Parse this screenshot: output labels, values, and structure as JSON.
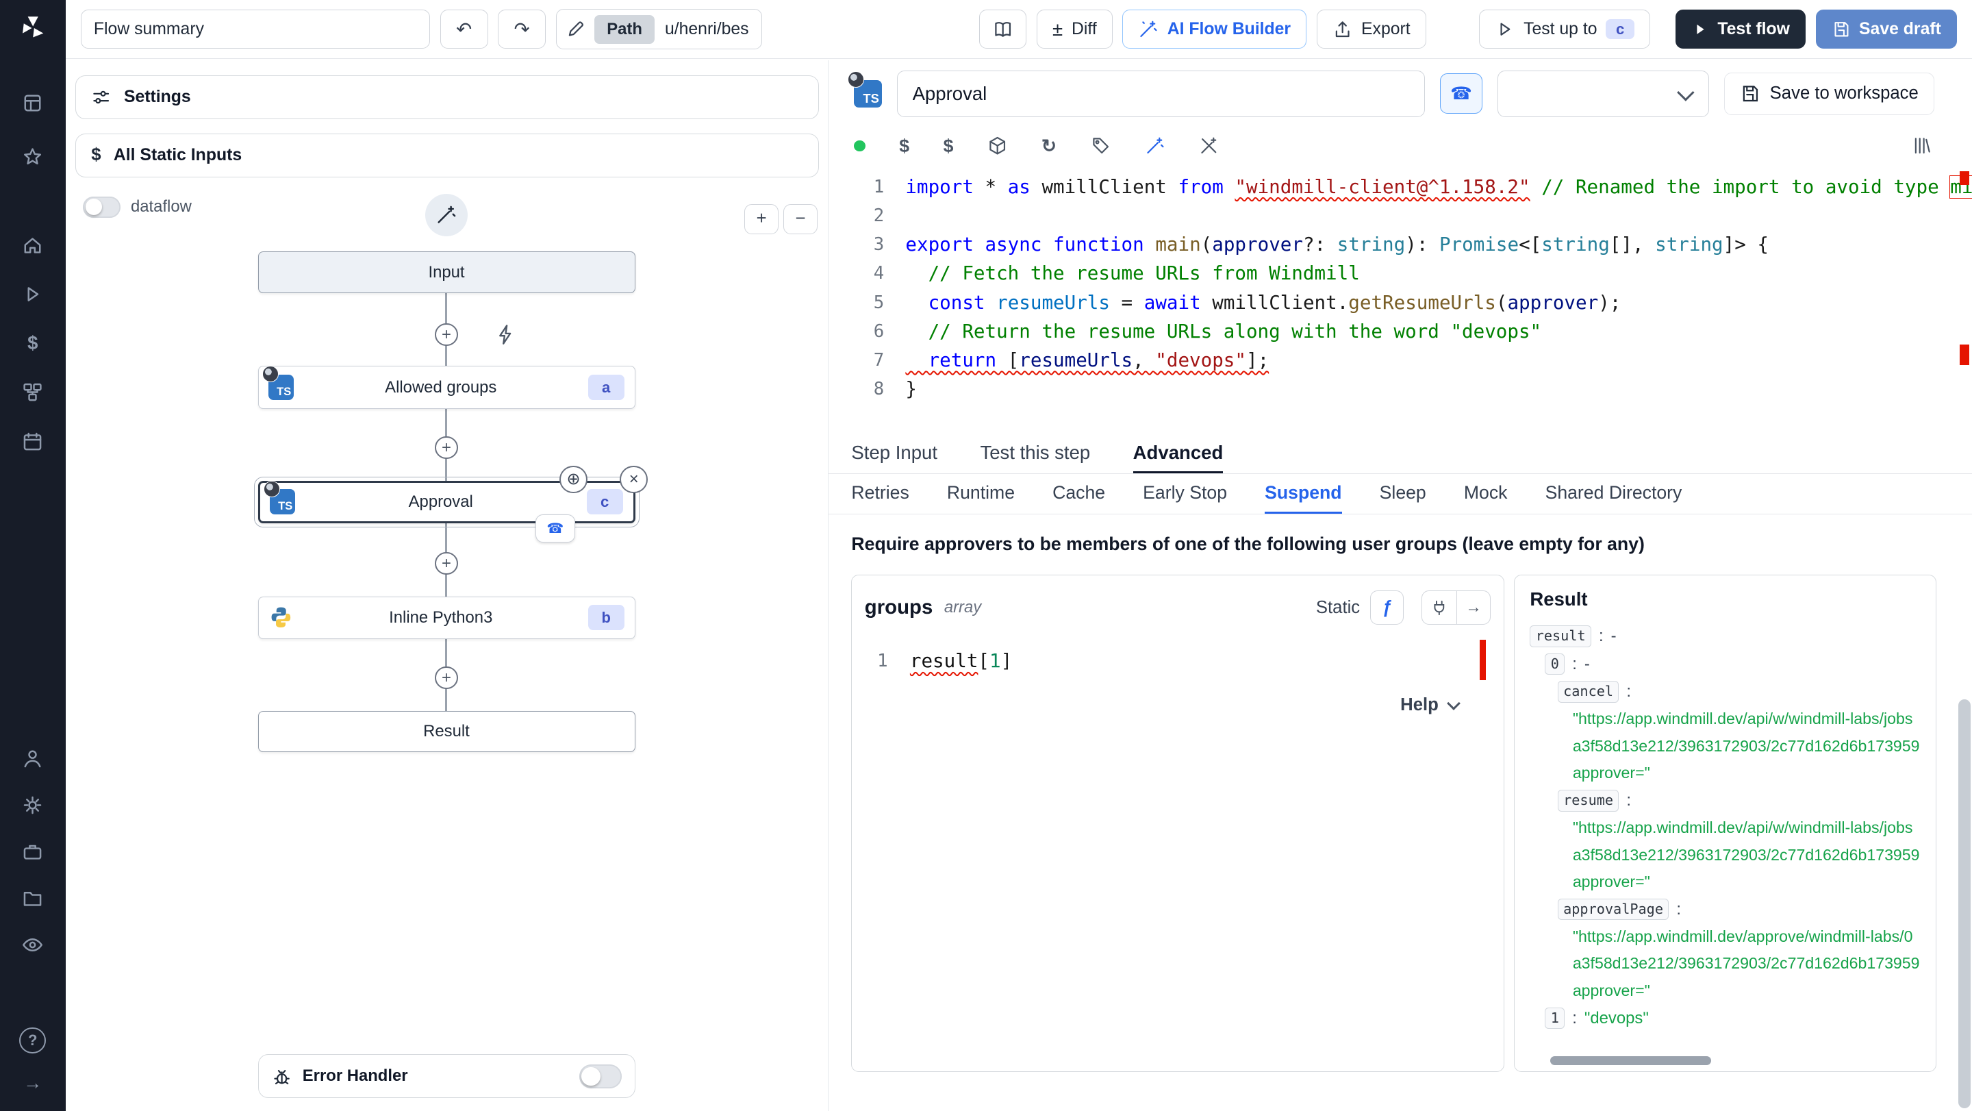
{
  "icons": {
    "plus": "+",
    "close": "×",
    "move": "⊕",
    "phone": "☎",
    "undo": "↶",
    "redo": "↷",
    "reload": "↻",
    "diff": "±",
    "dollar": "$",
    "arrow_right": "→",
    "fx": "ƒ",
    "help_q": "?"
  },
  "topbar": {
    "flow_summary": "Flow summary",
    "path_label": "Path",
    "path_value": "u/henri/bes",
    "diff": "Diff",
    "ai_builder": "AI Flow Builder",
    "export": "Export",
    "test_up_to": "Test up to",
    "test_up_to_badge": "c",
    "test_flow": "Test flow",
    "save_draft": "Save draft"
  },
  "graph": {
    "settings": "Settings",
    "all_static_inputs": "All Static Inputs",
    "dataflow": "dataflow",
    "zoom_in": "+",
    "zoom_out": "−",
    "error_handler": "Error Handler",
    "ts_label": "TS",
    "nodes": {
      "input": "Input",
      "allowed_groups": "Allowed groups",
      "allowed_badge": "a",
      "approval": "Approval",
      "approval_badge": "c",
      "python": "Inline Python3",
      "python_badge": "b",
      "result": "Result"
    }
  },
  "step": {
    "name": "Approval",
    "save_to_workspace": "Save to workspace"
  },
  "editor": {
    "line_numbers": [
      "1",
      "2",
      "3",
      "4",
      "5",
      "6",
      "7",
      "8"
    ],
    "l1": [
      "import",
      " * ",
      "as",
      " wmillClient ",
      "from",
      " ",
      "\"windmill-client@^1.158.2\"",
      " ",
      "// Renamed the import to avoid type ",
      "mi"
    ],
    "l3": [
      "export",
      " ",
      "async",
      " ",
      "function",
      " ",
      "main",
      "(",
      "approver",
      "?: ",
      "string",
      "): ",
      "Promise",
      "<[",
      "string",
      "[], ",
      "string",
      "]> {"
    ],
    "l4": [
      "  // Fetch the resume URLs from Windmill"
    ],
    "l5": [
      "  ",
      "const",
      " ",
      "resumeUrls",
      " = ",
      "await",
      " ",
      "wmillClient",
      ".",
      "getResumeUrls",
      "(",
      "approver",
      ");"
    ],
    "l6": [
      "  // Return the resume URLs along with the word \"devops\""
    ],
    "l7": [
      "  ",
      "return",
      " [",
      "resumeUrls",
      ", ",
      "\"devops\"",
      "];"
    ],
    "l8": [
      "}"
    ]
  },
  "tabs": {
    "step": [
      "Step Input",
      "Test this step",
      "Advanced"
    ],
    "advanced": [
      "Retries",
      "Runtime",
      "Cache",
      "Early Stop",
      "Suspend",
      "Sleep",
      "Mock",
      "Shared Directory"
    ]
  },
  "suspend": {
    "heading": "Require approvers to be members of one of the following user groups (leave empty for any)",
    "groups_label": "groups",
    "groups_type": "array",
    "static_label": "Static",
    "line_no": "1",
    "expr": [
      "result",
      "[",
      "1",
      "]"
    ],
    "help": "Help"
  },
  "result_panel": {
    "title": "Result",
    "colon": ":",
    "dash": "-",
    "devops": "\"devops\"",
    "rows": {
      "result": "result",
      "zero": "0",
      "cancel": "cancel",
      "resume": "resume",
      "approval_page": "approvalPage",
      "one": "1"
    },
    "jobs_link": [
      "\"https://app.windmill.dev/api/w/windmill-labs/jobs",
      "a3f58d13e212/3963172903/2c77d162d6b173959",
      "approver=\""
    ],
    "approve_link": [
      "\"https://app.windmill.dev/approve/windmill-labs/0",
      "a3f58d13e212/3963172903/2c77d162d6b173959",
      "approver=\""
    ]
  },
  "colors": {
    "accent": "#2563eb",
    "primary_button": "#1f2937",
    "save_draft": "#5e87cb",
    "string_green": "#16a34a",
    "error": "#e51400",
    "badge_bg": "#dbe2fd",
    "badge_text": "#3f51c1"
  }
}
